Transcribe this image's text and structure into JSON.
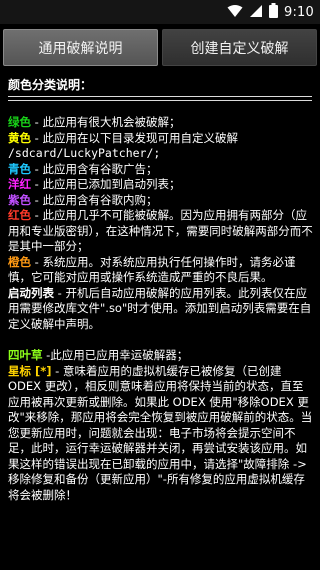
{
  "status_bar": {
    "time": "9:10",
    "icons": [
      "wifi-icon",
      "signal-icon",
      "battery-icon"
    ]
  },
  "tabs": [
    {
      "label": "通用破解说明",
      "active": true
    },
    {
      "label": "创建自定义破解",
      "active": false
    }
  ],
  "help": {
    "heading": "颜色分类说明：",
    "entries": [
      {
        "key": "绿色",
        "text": " - 此应用有很大机会被破解；",
        "color": "#19d319"
      },
      {
        "key": "黄色",
        "text": " - 此应用在以下目录发现可用自定义破解",
        "color": "#ffff00"
      },
      {
        "path": "/sdcard/LuckyPatcher/;"
      },
      {
        "key": "青色",
        "text": " - 此应用含有谷歌广告；",
        "color": "#1ec8ff"
      },
      {
        "key": "洋红",
        "text": " - 此应用已添加到启动列表；",
        "color": "#ff22ff"
      },
      {
        "key": "紫色",
        "text": " - 此应用含有谷歌内购；",
        "color": "#c050ff"
      },
      {
        "key": "红色",
        "text": " - 此应用几乎不可能被破解。因为应用拥有两部分（应用和专业版密钥），在这种情况下，需要同时破解两部分而不是其中一部分；",
        "color": "#ff3a2a"
      },
      {
        "key": "橙色",
        "text": " - 系统应用。对系统应用执行任何操作时，请务必谨慎，它可能对应用或操作系统造成严重的不良后果。",
        "color": "#ff9a14"
      },
      {
        "key": "启动列表",
        "text": " - 开机后自动应用破解的应用列表。此列表仅在应用需要修改库文件\".so\"时才使用。添加到启动列表需要在自定义破解中声明。",
        "color": "#ffffff"
      }
    ],
    "extra_entries": [
      {
        "key": "四叶草",
        "text": " -此应用已应用幸运破解器；",
        "color": "#8cff1a"
      },
      {
        "key": "星标 [*]",
        "text": " - 意味着应用的虚拟机缓存已被修复（已创建ODEX 更改），相反则意味着应用将保持当前的状态，直至应用被再次更新或删除。如果此 ODEX 使用\"移除ODEX 更改\"来移除，那应用将会完全恢复到被应用破解前的状态。当您更新应用时，问题就会出现：电子市场将会提示空间不足，此时，运行幸运破解器并关闭，再尝试安装该应用。如果这样的错误出现在已卸载的应用中，请选择\"故障排除 -> 移除修复和备份（更新应用）\"-所有修复的应用虚拟机缓存将会被删除！",
        "color": "#ffd400"
      }
    ]
  }
}
